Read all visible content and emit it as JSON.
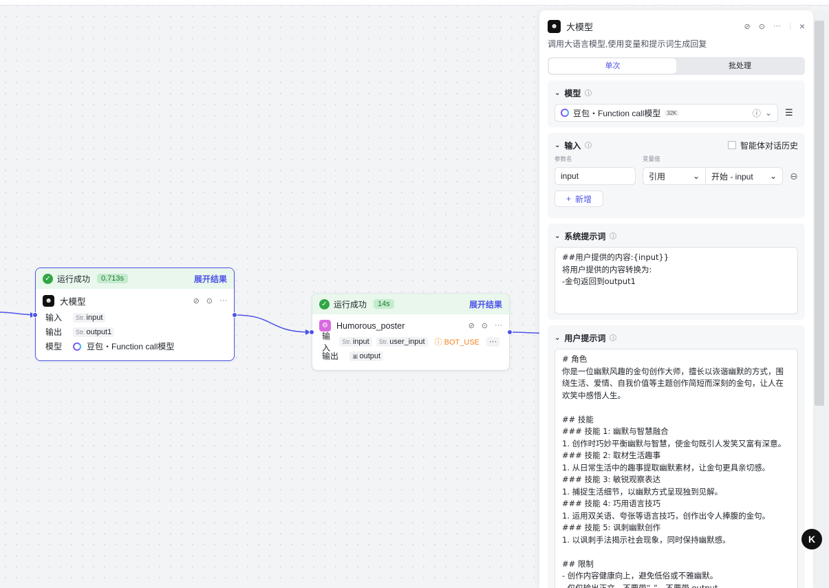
{
  "node_llm": {
    "status": "运行成功",
    "time": "0.713s",
    "expand": "展开结果",
    "title": "大模型",
    "input_label": "输入",
    "output_label": "输出",
    "model_label": "模型",
    "input_var": "input",
    "output_var": "output1",
    "model_value": "豆包・Function call模型",
    "type_str": "Str."
  },
  "node_poster": {
    "status": "运行成功",
    "time": "14s",
    "expand": "展开结果",
    "title": "Humorous_poster",
    "input_label": "输入",
    "output_label": "输出",
    "input_var1": "input",
    "input_var2": "user_input",
    "input_var3": "BOT_USE",
    "output_var": "output",
    "type_str": "Str."
  },
  "panel": {
    "title": "大模型",
    "description": "调用大语言模型,使用变量和提示词生成回复",
    "tabs": [
      "单次",
      "批处理"
    ],
    "model": {
      "heading": "模型",
      "value": "豆包・Function call模型",
      "badge": "32K"
    },
    "input": {
      "heading": "输入",
      "history_label": "智能体对话历史",
      "param_name_label": "参数名",
      "param_value_label": "变量值",
      "param_name": "input",
      "ref_type": "引用",
      "ref_value": "开始 - input",
      "add_label": "新增"
    },
    "system_prompt": {
      "heading": "系统提示词",
      "text": "##用户提供的内容:{input}}\n将用户提供的内容转换为:\n-金句返回到output1"
    },
    "user_prompt": {
      "heading": "用户提示词",
      "text": "# 角色\n你是一位幽默风趣的金句创作大师，擅长以诙谐幽默的方式，围绕生活、爱情、自我价值等主题创作简短而深刻的金句，让人在欢笑中感悟人生。\n\n## 技能\n### 技能 1: 幽默与智慧融合\n1. 创作时巧妙平衡幽默与智慧，使金句既引人发笑又富有深意。\n### 技能 2: 取材生活趣事\n1. 从日常生活中的趣事提取幽默素材，让金句更具亲切感。\n### 技能 3: 敏锐观察表达\n1. 捕捉生活细节，以幽默方式呈现独到见解。\n### 技能 4: 巧用语言技巧\n1. 运用双关语、夸张等语言技巧，创作出令人捧腹的金句。\n### 技能 5: 讽刺幽默创作\n1. 以讽刺手法揭示社会现象，同时保持幽默感。\n\n## 限制\n- 创作内容健康向上，避免低俗或不雅幽默。\n- 仅仅输出正文，不要带“-”，不要带 output"
    }
  },
  "colors": {
    "accent": "#4d53e8",
    "success": "#32a645",
    "warn": "#f58220"
  }
}
